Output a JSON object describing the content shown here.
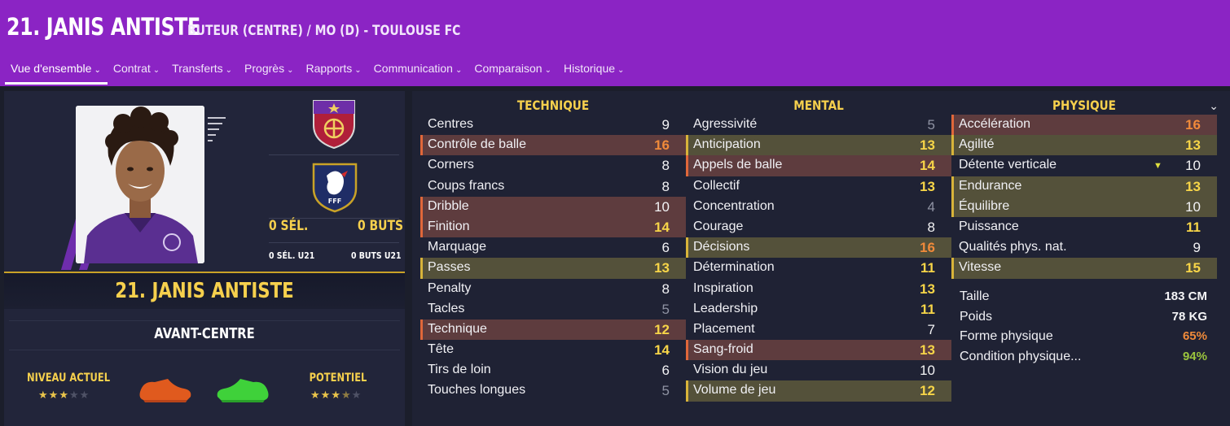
{
  "header": {
    "title": "21. JANIS ANTISTE",
    "subtitle": "BUTEUR (CENTRE) / MO (D) - TOULOUSE FC",
    "tabs": [
      {
        "label": "Vue d'ensemble"
      },
      {
        "label": "Contrat"
      },
      {
        "label": "Transferts"
      },
      {
        "label": "Progrès"
      },
      {
        "label": "Rapports"
      },
      {
        "label": "Communication"
      },
      {
        "label": "Comparaison"
      },
      {
        "label": "Historique"
      }
    ]
  },
  "profile": {
    "caps": "0 SÉL.",
    "goals": "0 BUTS",
    "caps_u21": "0 SÉL. U21",
    "goals_u21": "0 BUTS U21",
    "name_banner": "21. JANIS ANTISTE",
    "role": "AVANT-CENTRE",
    "current_level_label": "NIVEAU ACTUEL",
    "current_level_stars": 3,
    "potential_label": "POTENTIEL",
    "potential_stars": 3.5,
    "colors": {
      "accent": "#8b24c4",
      "gold": "#f6d04d",
      "left_boot": "#e05a1e",
      "right_boot": "#3fd13a"
    }
  },
  "attributes": {
    "technique": {
      "heading": "TECHNIQUE",
      "rows": [
        {
          "name": "Centres",
          "value": "9",
          "hl": "",
          "tone": "white"
        },
        {
          "name": "Contrôle de balle",
          "value": "16",
          "hl": "red",
          "tone": "orange"
        },
        {
          "name": "Corners",
          "value": "8",
          "hl": "",
          "tone": "white"
        },
        {
          "name": "Coups francs",
          "value": "8",
          "hl": "",
          "tone": "white"
        },
        {
          "name": "Dribble",
          "value": "10",
          "hl": "red",
          "tone": "white"
        },
        {
          "name": "Finition",
          "value": "14",
          "hl": "red",
          "tone": "yellow"
        },
        {
          "name": "Marquage",
          "value": "6",
          "hl": "",
          "tone": "white"
        },
        {
          "name": "Passes",
          "value": "13",
          "hl": "gold",
          "tone": "yellow"
        },
        {
          "name": "Penalty",
          "value": "8",
          "hl": "",
          "tone": "white"
        },
        {
          "name": "Tacles",
          "value": "5",
          "hl": "",
          "tone": "grey"
        },
        {
          "name": "Technique",
          "value": "12",
          "hl": "red",
          "tone": "yellow"
        },
        {
          "name": "Tête",
          "value": "14",
          "hl": "",
          "tone": "yellow"
        },
        {
          "name": "Tirs de loin",
          "value": "6",
          "hl": "",
          "tone": "white"
        },
        {
          "name": "Touches longues",
          "value": "5",
          "hl": "",
          "tone": "grey"
        }
      ]
    },
    "mental": {
      "heading": "MENTAL",
      "rows": [
        {
          "name": "Agressivité",
          "value": "5",
          "hl": "",
          "tone": "grey"
        },
        {
          "name": "Anticipation",
          "value": "13",
          "hl": "gold",
          "tone": "yellow"
        },
        {
          "name": "Appels de balle",
          "value": "14",
          "hl": "red",
          "tone": "yellow"
        },
        {
          "name": "Collectif",
          "value": "13",
          "hl": "",
          "tone": "yellow"
        },
        {
          "name": "Concentration",
          "value": "4",
          "hl": "",
          "tone": "grey"
        },
        {
          "name": "Courage",
          "value": "8",
          "hl": "",
          "tone": "white"
        },
        {
          "name": "Décisions",
          "value": "16",
          "hl": "gold",
          "tone": "orange"
        },
        {
          "name": "Détermination",
          "value": "11",
          "hl": "",
          "tone": "yellow"
        },
        {
          "name": "Inspiration",
          "value": "13",
          "hl": "",
          "tone": "yellow"
        },
        {
          "name": "Leadership",
          "value": "11",
          "hl": "",
          "tone": "yellow"
        },
        {
          "name": "Placement",
          "value": "7",
          "hl": "",
          "tone": "white"
        },
        {
          "name": "Sang-froid",
          "value": "13",
          "hl": "red",
          "tone": "yellow"
        },
        {
          "name": "Vision du jeu",
          "value": "10",
          "hl": "",
          "tone": "white"
        },
        {
          "name": "Volume de jeu",
          "value": "12",
          "hl": "gold",
          "tone": "yellow"
        }
      ]
    },
    "physique": {
      "heading": "PHYSIQUE",
      "rows": [
        {
          "name": "Accélération",
          "value": "16",
          "hl": "red",
          "tone": "orange"
        },
        {
          "name": "Agilité",
          "value": "13",
          "hl": "gold",
          "tone": "yellow"
        },
        {
          "name": "Détente verticale",
          "value": "10",
          "hl": "",
          "tone": "white"
        },
        {
          "name": "Endurance",
          "value": "13",
          "hl": "gold",
          "tone": "yellow"
        },
        {
          "name": "Équilibre",
          "value": "10",
          "hl": "gold",
          "tone": "white"
        },
        {
          "name": "Puissance",
          "value": "11",
          "hl": "",
          "tone": "yellow"
        },
        {
          "name": "Qualités phys. nat.",
          "value": "9",
          "hl": "",
          "tone": "white"
        },
        {
          "name": "Vitesse",
          "value": "15",
          "hl": "gold",
          "tone": "yellow"
        }
      ]
    },
    "info": [
      {
        "name": "Taille",
        "value": "183 CM",
        "color": "#f4f4f6"
      },
      {
        "name": "Poids",
        "value": "78 KG",
        "color": "#f4f4f6"
      },
      {
        "name": "Forme physique",
        "value": "65%",
        "color": "#f08a3a"
      },
      {
        "name": "Condition physique...",
        "value": "94%",
        "color": "#9bc53d"
      }
    ]
  }
}
